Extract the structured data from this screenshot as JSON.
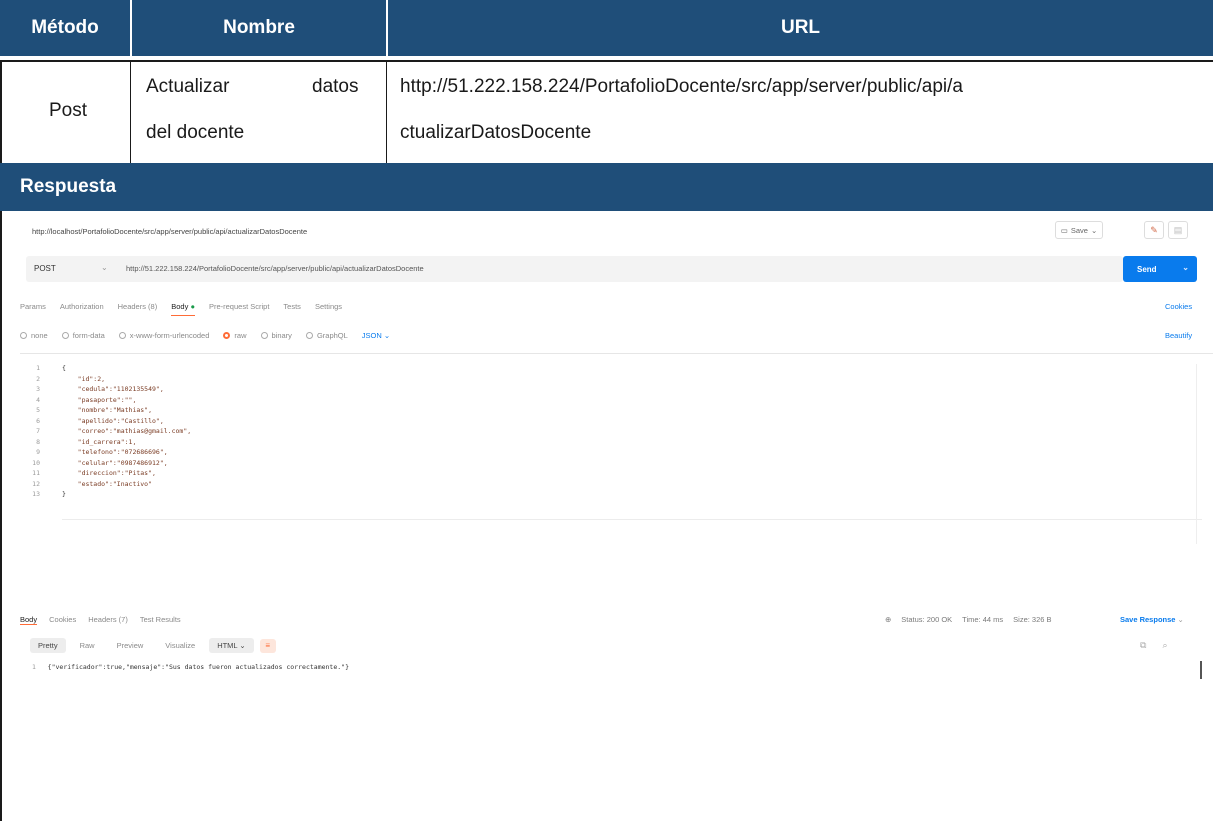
{
  "table": {
    "headers": [
      "Método",
      "Nombre",
      "URL"
    ],
    "row": {
      "metodo": "Post",
      "nombre_line1_a": "Actualizar",
      "nombre_line1_b": "datos",
      "nombre_line2": "del docente",
      "url_line1": "http://51.222.158.224/PortafolioDocente/src/app/server/public/api/a",
      "url_line2": "ctualizarDatosDocente"
    },
    "respuesta_label": "Respuesta"
  },
  "postman": {
    "top_url": "http://localhost/PortafolioDocente/src/app/server/public/api/actualizarDatosDocente",
    "save_label": "Save",
    "method": "POST",
    "request_url": "http://51.222.158.224/PortafolioDocente/src/app/server/public/api/actualizarDatosDocente",
    "send_label": "Send",
    "tabs": [
      "Params",
      "Authorization",
      "Headers (8)",
      "Body",
      "Pre-request Script",
      "Tests",
      "Settings"
    ],
    "cookies_label": "Cookies",
    "body_types": [
      "none",
      "form-data",
      "x-www-form-urlencoded",
      "raw",
      "binary",
      "GraphQL"
    ],
    "body_format": "JSON",
    "beautify_label": "Beautify",
    "line_numbers": [
      "1",
      "2",
      "3",
      "4",
      "5",
      "6",
      "7",
      "8",
      "9",
      "10",
      "11",
      "12",
      "13"
    ],
    "code_lines": [
      "{",
      "    \"id\":2,",
      "    \"cedula\":\"1102135549\",",
      "    \"pasaporte\":\"\",",
      "    \"nombre\":\"Mathias\",",
      "    \"apellido\":\"Castillo\",",
      "    \"correo\":\"mathias@gmail.com\",",
      "    \"id_carrera\":1,",
      "    \"telefono\":\"072686696\",",
      "    \"celular\":\"0987486912\",",
      "    \"direccion\":\"Pitas\",",
      "    \"estado\":\"Inactivo\"",
      "}"
    ],
    "response_tabs": [
      "Body",
      "Cookies",
      "Headers (7)",
      "Test Results"
    ],
    "status": "Status: 200 OK",
    "time": "Time: 44 ms",
    "size": "Size: 326 B",
    "save_response_label": "Save Response",
    "formats": [
      "Pretty",
      "Raw",
      "Preview",
      "Visualize"
    ],
    "response_format": "HTML",
    "response_line_number": "1",
    "response_body": "{\"verificador\":true,\"mensaje\":\"Sus datos fueron actualizados correctamente.\"}"
  }
}
